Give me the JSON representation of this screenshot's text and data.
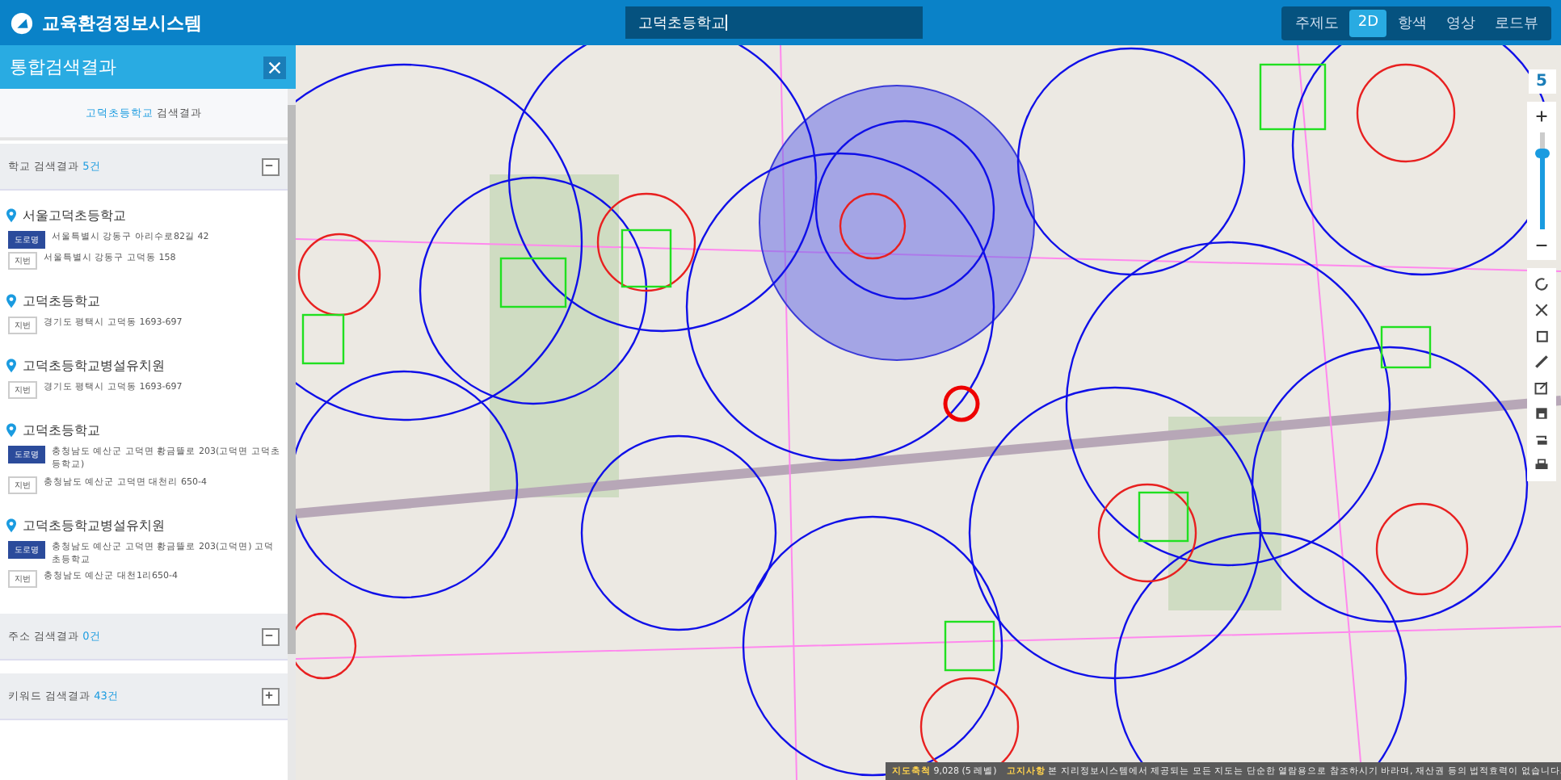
{
  "header": {
    "title": "교육환경정보시스템",
    "search_value": "고덕초등학교",
    "map_tabs": [
      {
        "label": "주제도",
        "selected": false
      },
      {
        "label": "2D",
        "selected": true
      },
      {
        "label": "항색",
        "selected": false
      },
      {
        "label": "영상",
        "selected": false
      },
      {
        "label": "로드뷰",
        "selected": false
      }
    ]
  },
  "sidebar": {
    "title": "통합검색결과",
    "query": "고덕초등학교",
    "query_suffix": "검색결과",
    "sections": [
      {
        "label": "학교 검색결과",
        "count": "5건",
        "expanded": true,
        "results": [
          {
            "name": "서울고덕초등학교",
            "addresses": [
              {
                "kind": "road",
                "tag": "도로명",
                "text": "서울특별시 강동구 아리수로82길 42"
              },
              {
                "kind": "lot",
                "tag": "지번",
                "text": "서울특별시 강동구 고덕동 158"
              }
            ]
          },
          {
            "name": "고덕초등학교",
            "addresses": [
              {
                "kind": "lot",
                "tag": "지번",
                "text": "경기도 평택시 고덕동 1693-697"
              }
            ]
          },
          {
            "name": "고덕초등학교병설유치원",
            "addresses": [
              {
                "kind": "lot",
                "tag": "지번",
                "text": "경기도 평택시 고덕동 1693-697"
              }
            ]
          },
          {
            "name": "고덕초등학교",
            "addresses": [
              {
                "kind": "road",
                "tag": "도로명",
                "text": "충청남도 예산군 고덕면 황금뜰로 203(고덕면 고덕초등학교)"
              },
              {
                "kind": "lot",
                "tag": "지번",
                "text": "충청남도 예산군 고덕면 대천리 650-4"
              }
            ]
          },
          {
            "name": "고덕초등학교병설유치원",
            "addresses": [
              {
                "kind": "road",
                "tag": "도로명",
                "text": "충청남도 예산군 고덕면 황금뜰로 203(고덕면) 고덕초등학교"
              },
              {
                "kind": "lot",
                "tag": "지번",
                "text": "충청남도 예산군 대천1리650-4"
              }
            ]
          }
        ]
      },
      {
        "label": "주소 검색결과",
        "count": "0건",
        "expanded": true
      },
      {
        "label": "키워드 검색결과",
        "count": "43건",
        "expanded": false
      }
    ]
  },
  "map": {
    "zoom_level": "5",
    "zoom": {
      "level": 0.78
    },
    "status": {
      "scale_label": "지도축척",
      "scale_value": "9,028 (5 레벨)",
      "notice_label": "고지사항",
      "notice": "본 지리정보시스템에서 제공되는 모든 지도는 단순한 열람용으로 참조하시기 바라며, 재산권 등의 법적효력이 없습니다."
    }
  }
}
